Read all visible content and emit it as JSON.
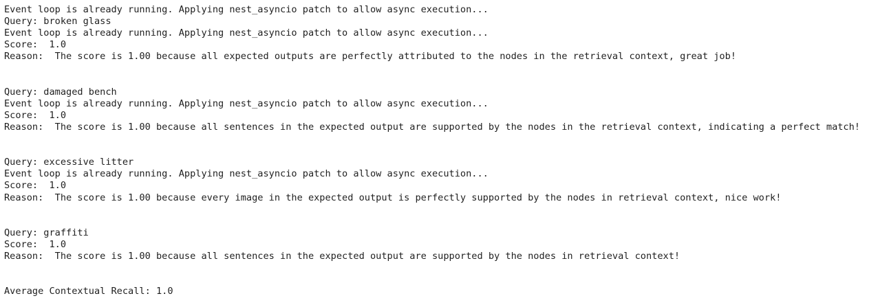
{
  "output": {
    "lines": [
      "Event loop is already running. Applying nest_asyncio patch to allow async execution...",
      "Query: broken glass",
      "Event loop is already running. Applying nest_asyncio patch to allow async execution...",
      "Score:  1.0",
      "Reason:  The score is 1.00 because all expected outputs are perfectly attributed to the nodes in the retrieval context, great job!",
      "",
      "",
      "Query: damaged bench",
      "Event loop is already running. Applying nest_asyncio patch to allow async execution...",
      "Score:  1.0",
      "Reason:  The score is 1.00 because all sentences in the expected output are supported by the nodes in the retrieval context, indicating a perfect match!",
      "",
      "",
      "Query: excessive litter",
      "Event loop is already running. Applying nest_asyncio patch to allow async execution...",
      "Score:  1.0",
      "Reason:  The score is 1.00 because every image in the expected output is perfectly supported by the nodes in retrieval context, nice work!",
      "",
      "",
      "Query: graffiti",
      "Score:  1.0",
      "Reason:  The score is 1.00 because all sentences in the expected output are supported by the nodes in retrieval context!",
      "",
      "",
      "Average Contextual Recall: 1.0"
    ]
  }
}
